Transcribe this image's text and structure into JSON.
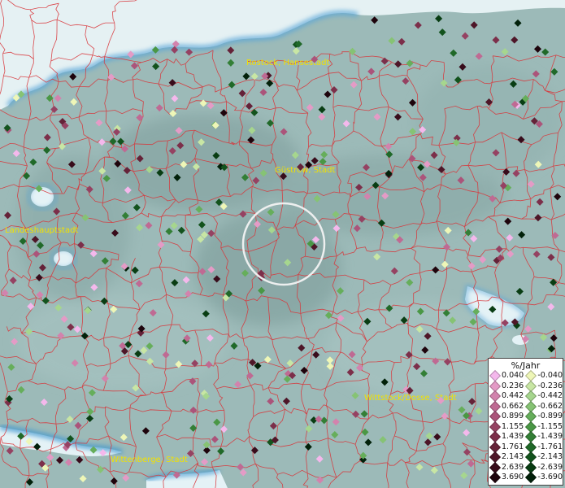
{
  "labels": {
    "rostock": "Rostock, Hansestadt",
    "guestrow": "Güstrow, Stadt",
    "landeshauptstadt": "Landeshauptstadt",
    "wittstock": "Wittstock/Dosse, Stadt",
    "wittenberge": "Wittenberge, Stadt"
  },
  "legend": {
    "title": "%/Jahr",
    "positive": [
      {
        "label": "0.040",
        "color": "#f4b8ec"
      },
      {
        "label": "0.236",
        "color": "#e49bc6"
      },
      {
        "label": "0.442",
        "color": "#d283ad"
      },
      {
        "label": "0.662",
        "color": "#bf6a93"
      },
      {
        "label": "0.899",
        "color": "#ab547a"
      },
      {
        "label": "1.155",
        "color": "#954262"
      },
      {
        "label": "1.439",
        "color": "#7c2f4a"
      },
      {
        "label": "1.761",
        "color": "#652238"
      },
      {
        "label": "2.143",
        "color": "#4e1628"
      },
      {
        "label": "2.639",
        "color": "#380c1b"
      },
      {
        "label": "3.690",
        "color": "#1e040c"
      }
    ],
    "negative": [
      {
        "label": "-0.040",
        "color": "#eef6b7"
      },
      {
        "label": "-0.236",
        "color": "#c8e6a4"
      },
      {
        "label": "-0.442",
        "color": "#a6d68e"
      },
      {
        "label": "-0.662",
        "color": "#86c374"
      },
      {
        "label": "-0.899",
        "color": "#66ae5b"
      },
      {
        "label": "-1.155",
        "color": "#4a9745"
      },
      {
        "label": "-1.439",
        "color": "#337f36"
      },
      {
        "label": "-1.761",
        "color": "#206929"
      },
      {
        "label": "-2.143",
        "color": "#13531d"
      },
      {
        "label": "-2.639",
        "color": "#093d13"
      },
      {
        "label": "-3.690",
        "color": "#02210a"
      }
    ]
  }
}
